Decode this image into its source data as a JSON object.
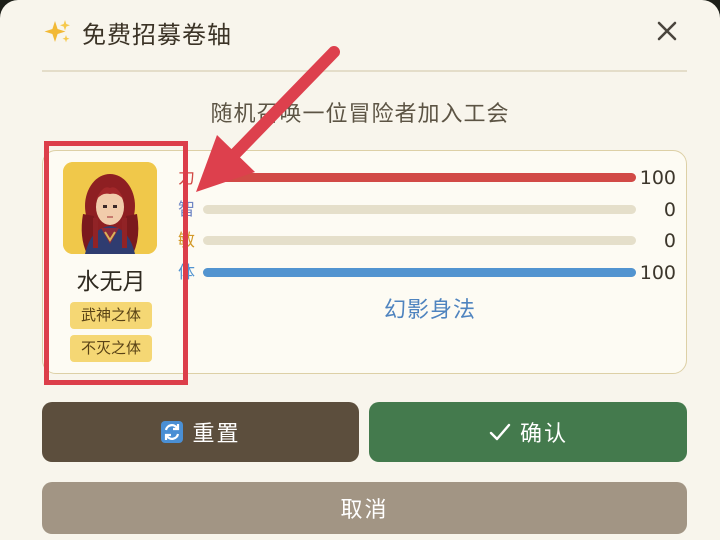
{
  "dialog": {
    "title": "免费招募卷轴",
    "subtitle": "随机召唤一位冒险者加入工会",
    "title_icon": "sparkle-icon",
    "close_icon": "close-icon"
  },
  "hero": {
    "name": "水无月",
    "portrait": "hero-portrait",
    "traits": [
      "武神之体",
      "不灭之体"
    ]
  },
  "stats": [
    {
      "label": "力",
      "value": "100",
      "fraction": 1.0,
      "color": "#d24a46",
      "label_color": "#d24a46"
    },
    {
      "label": "智",
      "value": "0",
      "fraction": 0.0,
      "color": "#6f86c4",
      "label_color": "#6f86c4"
    },
    {
      "label": "敏",
      "value": "0",
      "fraction": 0.0,
      "color": "#d39a2a",
      "label_color": "#d39a2a"
    },
    {
      "label": "体",
      "value": "100",
      "fraction": 1.0,
      "color": "#5294d0",
      "label_color": "#5294d0"
    }
  ],
  "skill": {
    "name": "幻影身法"
  },
  "buttons": {
    "reset_label": "重置",
    "reset_icon": "refresh-icon",
    "confirm_label": "确认",
    "confirm_icon": "checkmark-icon",
    "cancel_label": "取消"
  },
  "colors": {
    "highlight_box": "#dc3e4a",
    "annotation_arrow": "#dd404d",
    "reset_button": "#5c4e3d",
    "confirm_button": "#447a4d",
    "cancel_button": "#a29584",
    "trait_badge": "#f5d774"
  }
}
